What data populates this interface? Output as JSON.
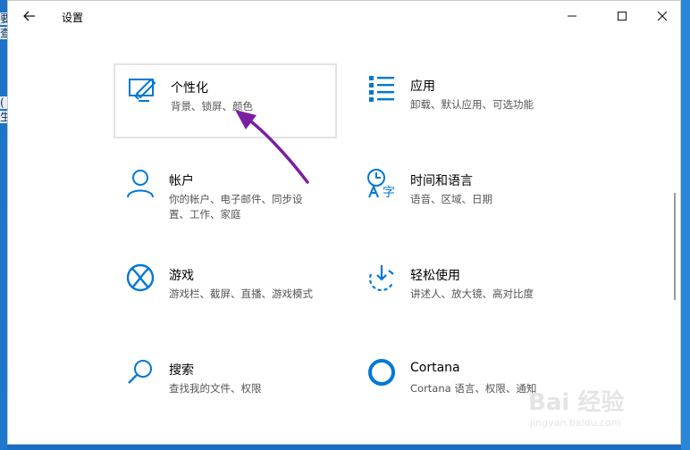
{
  "window": {
    "title": "设置"
  },
  "tiles": [
    {
      "name": "个性化",
      "desc": "背景、锁屏、颜色",
      "icon": "personalization-icon"
    },
    {
      "name": "应用",
      "desc": "卸载、默认应用、可选功能",
      "icon": "apps-icon"
    },
    {
      "name": "帐户",
      "desc": "你的帐户、电子邮件、同步设置、工作、家庭",
      "desc_line1": "你的帐户、电子邮件、同步设",
      "desc_line2": "置、工作、家庭",
      "icon": "account-icon"
    },
    {
      "name": "时间和语言",
      "desc": "语音、区域、日期",
      "icon": "time-language-icon"
    },
    {
      "name": "游戏",
      "desc": "游戏栏、截屏、直播、游戏模式",
      "icon": "xbox-icon"
    },
    {
      "name": "轻松使用",
      "desc": "讲述人、放大镜、高对比度",
      "icon": "ease-of-access-icon"
    },
    {
      "name": "搜索",
      "desc": "查找我的文件、权限",
      "icon": "search-icon"
    },
    {
      "name": "Cortana",
      "desc": "Cortana 语言、权限、通知",
      "icon": "cortana-icon"
    }
  ],
  "colors": {
    "accent": "#0078d7",
    "annotation_arrow": "#7b1fa2"
  },
  "desktop_chars": [
    "要",
    "查",
    "(",
    "生"
  ],
  "watermark": {
    "text": "Bai 经验",
    "sub": "jingyan.baidu.com"
  }
}
